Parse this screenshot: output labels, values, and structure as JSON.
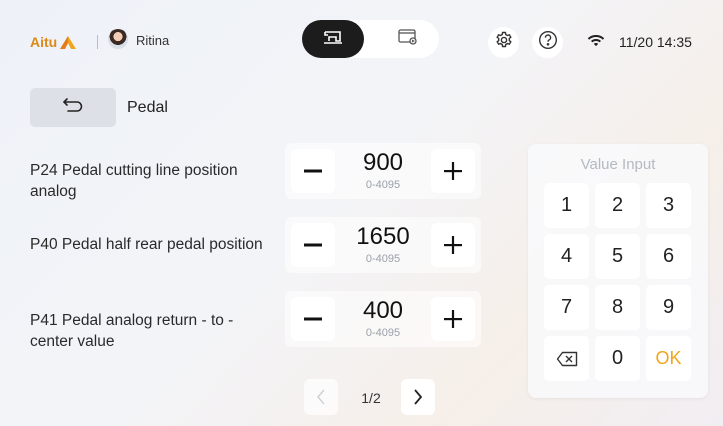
{
  "header": {
    "brand": "Aitu",
    "username": "Ritina",
    "datetime": "11/20 14:35",
    "icons": {
      "logo_mark": "aitu-logo-mark",
      "avatar": "user-avatar",
      "mode_sewing": "sewing-machine-icon",
      "mode_media": "video-playback-icon",
      "settings": "gear-icon",
      "help": "question-mark-icon",
      "wifi": "wifi-icon"
    }
  },
  "page": {
    "title": "Pedal",
    "back_icon": "return-arrow-icon"
  },
  "params": [
    {
      "label": "P24 Pedal cutting line position analog",
      "value": "900",
      "range": "0-4095"
    },
    {
      "label": "P40 Pedal half rear pedal position",
      "value": "1650",
      "range": "0-4095"
    },
    {
      "label": "P41 Pedal analog return - to - center value",
      "value": "400",
      "range": "0-4095"
    }
  ],
  "stepper_symbols": {
    "minus": "−",
    "plus": "+"
  },
  "pagination": {
    "indicator": "1/2"
  },
  "keypad": {
    "title": "Value Input",
    "keys": [
      "1",
      "2",
      "3",
      "4",
      "5",
      "6",
      "7",
      "8",
      "9",
      "⌫",
      "0",
      "OK"
    ]
  },
  "colors": {
    "accent": "#f0a61c",
    "brand": "#d98a18",
    "active_mode_bg": "#1c1c1c"
  }
}
